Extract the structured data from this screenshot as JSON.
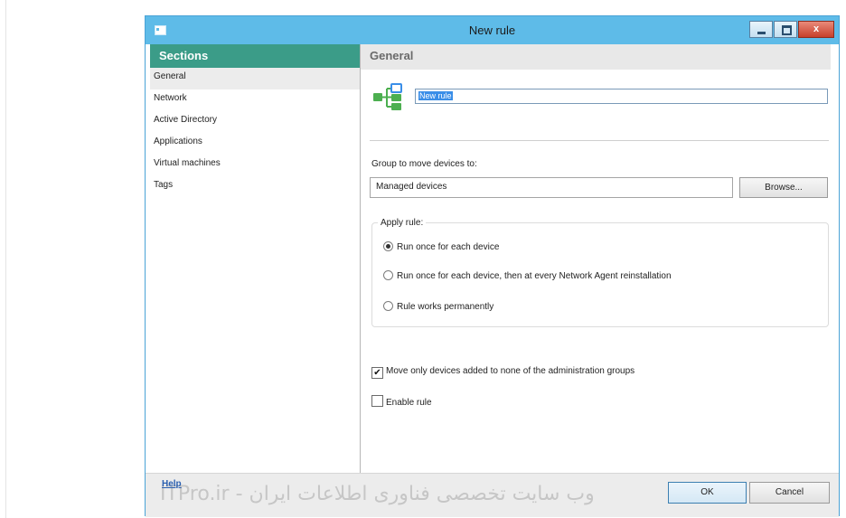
{
  "window": {
    "title": "New rule",
    "close_glyph": "x"
  },
  "sidebar": {
    "header": "Sections",
    "items": [
      {
        "label": "General"
      },
      {
        "label": "Network"
      },
      {
        "label": "Active Directory"
      },
      {
        "label": "Applications"
      },
      {
        "label": "Virtual machines"
      },
      {
        "label": "Tags"
      }
    ]
  },
  "main": {
    "header": "General",
    "rule_name_value": "New rule",
    "group_label": "Group to move devices to:",
    "group_value": "Managed devices",
    "browse_label": "Browse...",
    "apply_rule": {
      "legend": "Apply rule:",
      "options": [
        {
          "label": "Run once for each device",
          "selected": true
        },
        {
          "label": "Run once for each device, then at every Network Agent reinstallation",
          "selected": false
        },
        {
          "label": "Rule works permanently",
          "selected": false
        }
      ]
    },
    "checkboxes": [
      {
        "label": "Move only devices added to none of the administration groups",
        "checked": true
      },
      {
        "label": "Enable rule",
        "checked": false
      }
    ],
    "check_glyph": "✔"
  },
  "footer": {
    "help_label": "Help",
    "watermark": "ITPro.ir - وب سایت تخصصی فناوری اطلاعات ایران",
    "ok_label": "OK",
    "cancel_label": "Cancel"
  },
  "colors": {
    "titlebar": "#5ebbe8",
    "sections_header": "#3b9c88",
    "rule_icon": "#4caf50",
    "rule_icon_accent": "#3a8ee8"
  }
}
